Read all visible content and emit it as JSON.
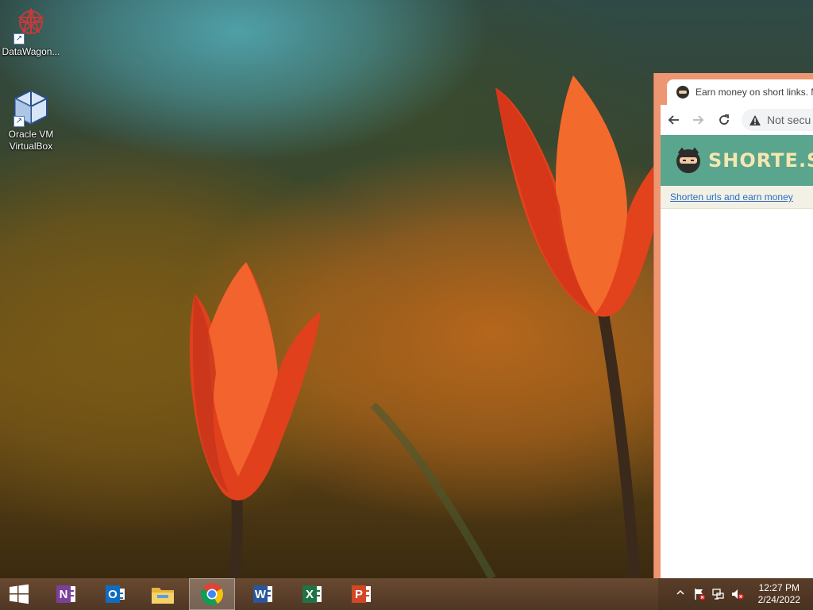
{
  "desktop": {
    "icons": [
      {
        "label": "DataWagon...",
        "icon": "datawagon-icon"
      },
      {
        "label": "Oracle VM\nVirtualBox",
        "icon": "virtualbox-icon"
      }
    ]
  },
  "browser": {
    "tab_title": "Earn money on short links. M",
    "omnibox_text": "Not secu",
    "site": {
      "logo_text": "SHORTE.ST",
      "tagline_link": "Shorten urls and earn money"
    },
    "colors": {
      "frame": "#ee9672",
      "site_header": "#5aa58d",
      "logo_text": "#f4e7b0"
    }
  },
  "taskbar": {
    "items": [
      {
        "name": "start",
        "icon": "windows-logo-icon"
      },
      {
        "name": "onenote",
        "icon": "onenote-icon",
        "letter": "N",
        "color": "#7b3f9e"
      },
      {
        "name": "outlook",
        "icon": "outlook-icon",
        "letter": "O",
        "color": "#0f6cbf"
      },
      {
        "name": "file-explorer",
        "icon": "folder-icon"
      },
      {
        "name": "chrome",
        "icon": "chrome-icon",
        "active": true
      },
      {
        "name": "word",
        "icon": "word-icon",
        "letter": "W",
        "color": "#2b579a"
      },
      {
        "name": "excel",
        "icon": "excel-icon",
        "letter": "X",
        "color": "#217346"
      },
      {
        "name": "powerpoint",
        "icon": "powerpoint-icon",
        "letter": "P",
        "color": "#d24726"
      }
    ],
    "tray": {
      "time": "12:27 PM",
      "date": "2/24/2022"
    }
  }
}
